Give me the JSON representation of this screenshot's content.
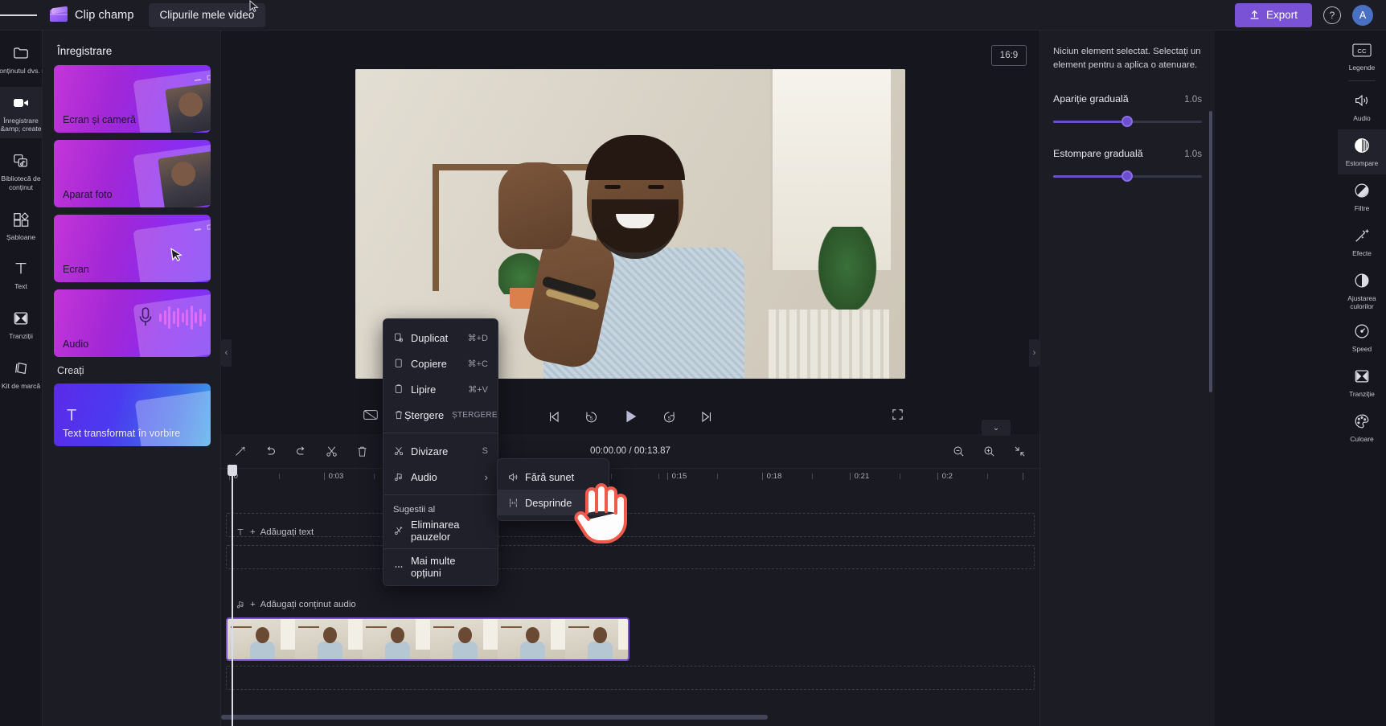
{
  "topbar": {
    "menu_icon": "hamburger-icon",
    "brand": "Clip champ",
    "tab_label": "Clipurile mele video",
    "export_label": "Export",
    "help_label": "?",
    "avatar_initial": "A",
    "accent": "#7a52d6"
  },
  "left_rail": [
    {
      "icon": "folder-icon",
      "label": "Conținutul dvs. media",
      "active": false
    },
    {
      "icon": "video-camera-icon",
      "label": "Înregistrare &amp;\ncreate",
      "active": true
    },
    {
      "icon": "content-library-icon",
      "label": "Bibliotecă de\nconținut",
      "active": false
    },
    {
      "icon": "templates-icon",
      "label": "Șabloane",
      "active": false
    },
    {
      "icon": "text-icon",
      "label": "Text",
      "active": false
    },
    {
      "icon": "transitions-icon",
      "label": "Tranziții",
      "active": false
    },
    {
      "icon": "brand-kit-icon",
      "label": "Kit de marcă",
      "active": false
    }
  ],
  "panel": {
    "heading": "Înregistrare",
    "cards": [
      {
        "label": "Ecran și cameră",
        "art": "screen-and-camera-art"
      },
      {
        "label": "Aparat foto",
        "art": "camera-art"
      },
      {
        "label": "Ecran",
        "art": "screen-art"
      },
      {
        "label": "Audio",
        "art": "audio-art"
      }
    ],
    "section_heading": "Creați",
    "create_cards": [
      {
        "label": "Text transformat în vorbire",
        "art": "tts-art"
      }
    ]
  },
  "stage": {
    "ratio_label": "16:9"
  },
  "player": {
    "captions_icon": "captions-off-icon",
    "skip_start_icon": "skip-to-start-icon",
    "back5_icon": "back-5s-icon",
    "play_icon": "play-icon",
    "fwd5_icon": "forward-5s-icon",
    "skip_end_icon": "skip-to-end-icon",
    "fullscreen_icon": "fullscreen-icon"
  },
  "timeline": {
    "tools": [
      {
        "icon": "magic-wand-icon",
        "name": "auto-compose"
      },
      {
        "icon": "undo-icon",
        "name": "undo"
      },
      {
        "icon": "redo-icon",
        "name": "redo"
      },
      {
        "icon": "scissors-icon",
        "name": "split"
      },
      {
        "icon": "trash-icon",
        "name": "delete"
      },
      {
        "icon": "duplicate-icon",
        "name": "duplicate"
      }
    ],
    "time_current": "00:00.00",
    "time_separator": "/",
    "time_total": "00:13.87",
    "zoom_out_icon": "zoom-out-icon",
    "zoom_in_icon": "zoom-in-icon",
    "fit_icon": "fit-to-timeline-icon",
    "collapse_icon": "chevron-down-icon",
    "ruler_ticks": [
      "0",
      "0:03",
      "0:15",
      "0:18",
      "0:21",
      "0:2"
    ],
    "add_text_label": "Adăugați text",
    "add_audio_label": "Adăugați conținut audio",
    "add_prefix": "+"
  },
  "context_menu": {
    "items": [
      {
        "icon": "duplicate-icon",
        "label": "Duplicat",
        "shortcut": "⌘+D",
        "type": "item"
      },
      {
        "icon": "copy-icon",
        "label": "Copiere",
        "shortcut": "⌘+C",
        "type": "item"
      },
      {
        "icon": "paste-icon",
        "label": "Lipire",
        "shortcut": "⌘+V",
        "type": "item"
      },
      {
        "icon": "trash-icon",
        "label": "Ștergere",
        "shortcut": "ȘTERGERE",
        "type": "item"
      },
      {
        "type": "separator"
      },
      {
        "icon": "scissors-icon",
        "label": "Divizare",
        "shortcut": "S",
        "type": "item"
      },
      {
        "icon": "music-note-icon",
        "label": "Audio",
        "shortcut": "",
        "type": "submenu"
      },
      {
        "type": "separator"
      },
      {
        "label": "Sugestii al",
        "type": "group"
      },
      {
        "icon": "ai-wand-icon",
        "label": "Eliminarea pauzelor",
        "shortcut": "",
        "type": "item"
      },
      {
        "type": "separator"
      },
      {
        "icon": "more-icon",
        "label": "Mai multe opțiuni",
        "shortcut": "",
        "type": "item"
      }
    ],
    "submenu": [
      {
        "icon": "speaker-mute-icon",
        "label": "Fără sunet",
        "selected": false
      },
      {
        "icon": "detach-icon",
        "label": "Desprinde",
        "selected": true
      }
    ]
  },
  "properties": {
    "empty_note": "Niciun element selectat. Selectați un element pentru a aplica o atenuare.",
    "rows": [
      {
        "label": "Apariție graduală",
        "value": "1.0s"
      },
      {
        "label": "Estompare graduală",
        "value": "1.0s"
      }
    ]
  },
  "right_rail": [
    {
      "icon": "captions-cc-icon",
      "label": "Legende",
      "active": false,
      "boxed": true
    },
    {
      "icon": "speaker-icon",
      "label": "Audio",
      "active": false
    },
    {
      "icon": "fade-icon",
      "label": "Estompare",
      "active": true
    },
    {
      "icon": "filters-icon",
      "label": "Filtre",
      "active": false
    },
    {
      "icon": "effects-wand-icon",
      "label": "Efecte",
      "active": false
    },
    {
      "icon": "color-adjust-icon",
      "label": "Ajustarea culorilor",
      "active": false
    },
    {
      "icon": "speed-gauge-icon",
      "label": "Speed",
      "active": false
    },
    {
      "icon": "transitions-icon",
      "label": "Tranziție",
      "active": false
    },
    {
      "icon": "palette-icon",
      "label": "Culoare",
      "active": false
    }
  ]
}
